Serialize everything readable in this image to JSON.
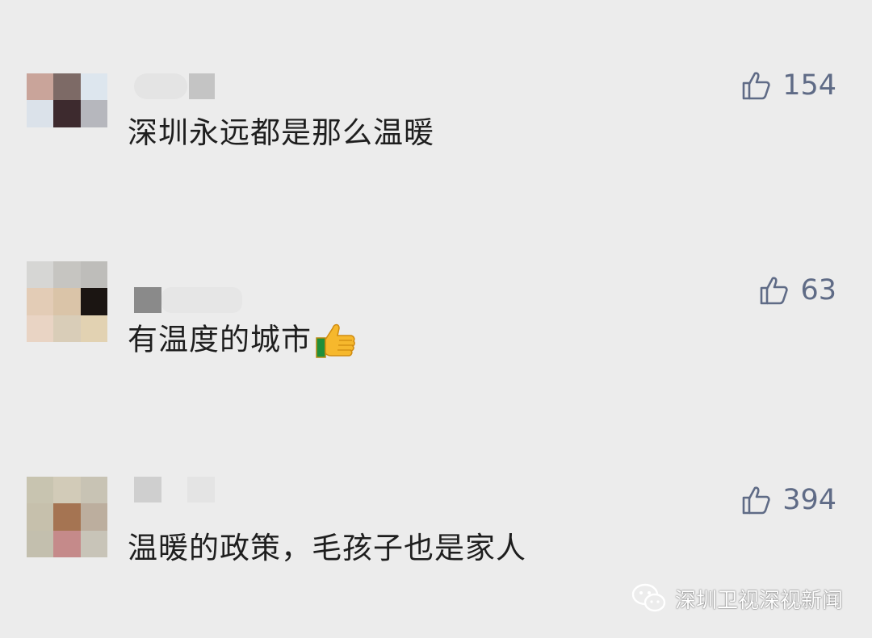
{
  "comments": [
    {
      "text": "深圳永远都是那么温暖",
      "likes": "154"
    },
    {
      "text": "有温度的城市",
      "emoji": "thumbs-up-emoji",
      "likes": "63"
    },
    {
      "text": "温暖的政策，毛孩子也是家人",
      "likes": "394"
    }
  ],
  "watermark": {
    "label": "深圳卫视深视新闻",
    "icon": "wechat-icon"
  },
  "colors": {
    "background": "#ececec",
    "text": "#1e1e1e",
    "like": "#5f6b86"
  }
}
